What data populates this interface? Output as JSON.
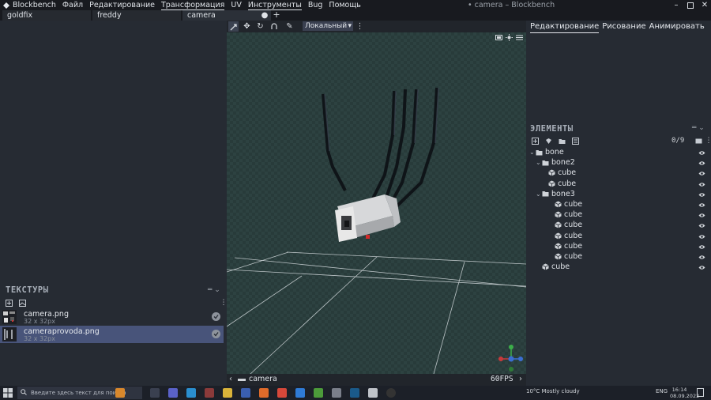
{
  "app": {
    "name": "Blockbench",
    "window_title": "• camera – Blockbench",
    "menu": [
      "Файл",
      "Редактирование",
      "Трансформация",
      "UV",
      "Инструменты",
      "Bug",
      "Помощь"
    ]
  },
  "tabs": {
    "items": [
      "goldfix",
      "freddy",
      "camera"
    ],
    "dot": "●",
    "add": "+"
  },
  "viewport": {
    "space_label": "Локальный",
    "bottom_label": "camera",
    "fps": "60FPS"
  },
  "modes": [
    "Редактирование",
    "Рисование",
    "Анимировать"
  ],
  "elements": {
    "title": "ЭЛЕМЕНТЫ",
    "count": "0/9",
    "tree": [
      {
        "label": "bone",
        "type": "group",
        "depth": 0,
        "open": true
      },
      {
        "label": "bone2",
        "type": "group",
        "depth": 1,
        "open": true
      },
      {
        "label": "cube",
        "type": "cube",
        "depth": 2
      },
      {
        "label": "cube",
        "type": "cube",
        "depth": 2
      },
      {
        "label": "bone3",
        "type": "group",
        "depth": 1,
        "open": true
      },
      {
        "label": "cube",
        "type": "cube",
        "depth": 3
      },
      {
        "label": "cube",
        "type": "cube",
        "depth": 3
      },
      {
        "label": "cube",
        "type": "cube",
        "depth": 3
      },
      {
        "label": "cube",
        "type": "cube",
        "depth": 3
      },
      {
        "label": "cube",
        "type": "cube",
        "depth": 3
      },
      {
        "label": "cube",
        "type": "cube",
        "depth": 3
      },
      {
        "label": "cube",
        "type": "cube",
        "depth": 1
      }
    ]
  },
  "textures": {
    "title": "ТЕКСТУРЫ",
    "items": [
      {
        "name": "camera.png",
        "size": "32 x 32px"
      },
      {
        "name": "cameraprovoda.png",
        "size": "32 x 32px"
      }
    ]
  },
  "taskbar": {
    "search_placeholder": "Введите здесь текст для поиска",
    "weather": "10°C  Mostly cloudy",
    "lang": "ENG",
    "time": "16:14",
    "date": "08.09.2022"
  },
  "colors": {
    "accent": "#48547a",
    "background": "#21252b",
    "panel": "#262b33",
    "viewport": "#2c4140"
  }
}
